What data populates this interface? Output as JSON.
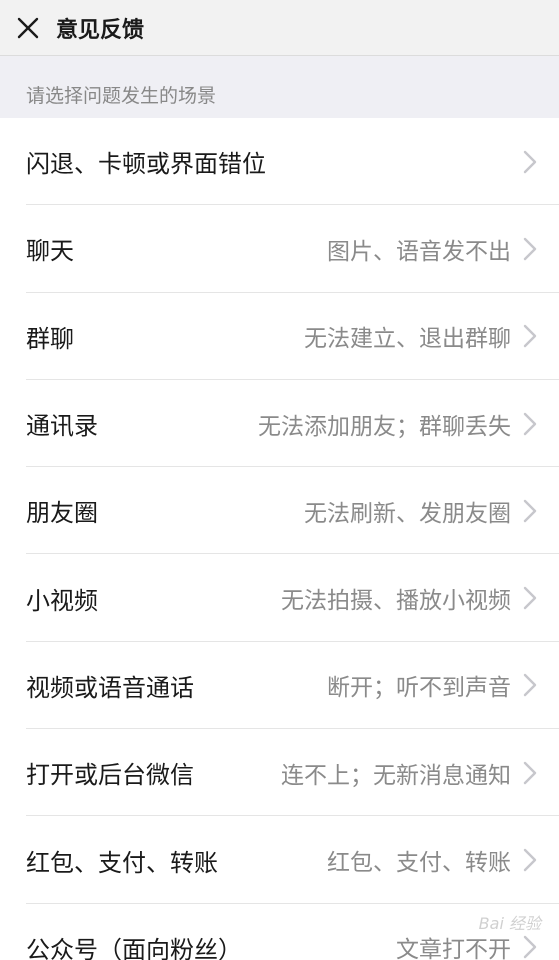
{
  "nav": {
    "title": "意见反馈",
    "close_icon": "close-icon"
  },
  "section": {
    "header": "请选择问题发生的场景"
  },
  "items": [
    {
      "title": "闪退、卡顿或界面错位",
      "detail": ""
    },
    {
      "title": "聊天",
      "detail": "图片、语音发不出"
    },
    {
      "title": "群聊",
      "detail": "无法建立、退出群聊"
    },
    {
      "title": "通讯录",
      "detail": "无法添加朋友；群聊丢失"
    },
    {
      "title": "朋友圈",
      "detail": "无法刷新、发朋友圈"
    },
    {
      "title": "小视频",
      "detail": "无法拍摄、播放小视频"
    },
    {
      "title": "视频或语音通话",
      "detail": "断开；听不到声音"
    },
    {
      "title": "打开或后台微信",
      "detail": "连不上；无新消息通知"
    },
    {
      "title": "红包、支付、转账",
      "detail": "红包、支付、转账"
    },
    {
      "title": "公众号（面向粉丝）",
      "detail": "文章打不开"
    }
  ],
  "watermark": "Bai 经验",
  "colors": {
    "nav_bg": "#f2f2f2",
    "section_bg": "#efeff4",
    "title_text": "#1a1a1a",
    "detail_text": "#8a8a8a",
    "chevron": "#c7c7cc"
  }
}
